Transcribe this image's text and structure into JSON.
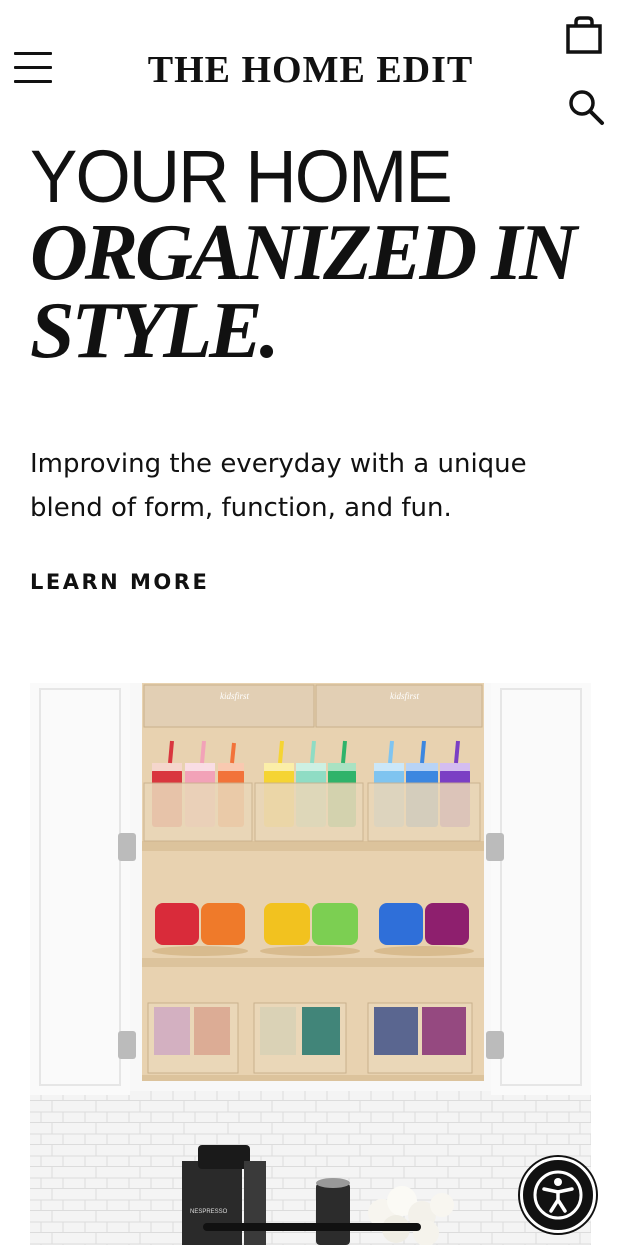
{
  "header": {
    "logo": "THE HOME EDIT",
    "menu_icon": "hamburger-menu-icon",
    "cart_icon": "shopping-bag-icon",
    "search_icon": "search-icon"
  },
  "hero": {
    "title_line1": "YOUR HOME",
    "title_line2": "ORGANIZED IN",
    "title_line3": "STYLE.",
    "subtitle": "Improving the everyday with a unique blend of form, function, and fun.",
    "cta": "LEARN MORE"
  },
  "image": {
    "bin_label_left": "kidsfirst",
    "bin_label_right": "kidsfirst",
    "machine_label": "NESPRESSO"
  },
  "accessibility": {
    "icon": "accessibility-icon"
  },
  "colors": {
    "text": "#111111",
    "background": "#ffffff",
    "wood": "#e8d2b0",
    "tumblers": [
      "#d9363e",
      "#f2a2b8",
      "#f2733a",
      "#f5d433",
      "#8fdcc4",
      "#2fb36a",
      "#7fc4f0",
      "#3c87e0",
      "#7b3fc4"
    ],
    "mugs": [
      "#d92b3a",
      "#ef7a2a",
      "#f2c21f",
      "#7ccf52",
      "#2f6fd9",
      "#8e1f6e"
    ]
  }
}
